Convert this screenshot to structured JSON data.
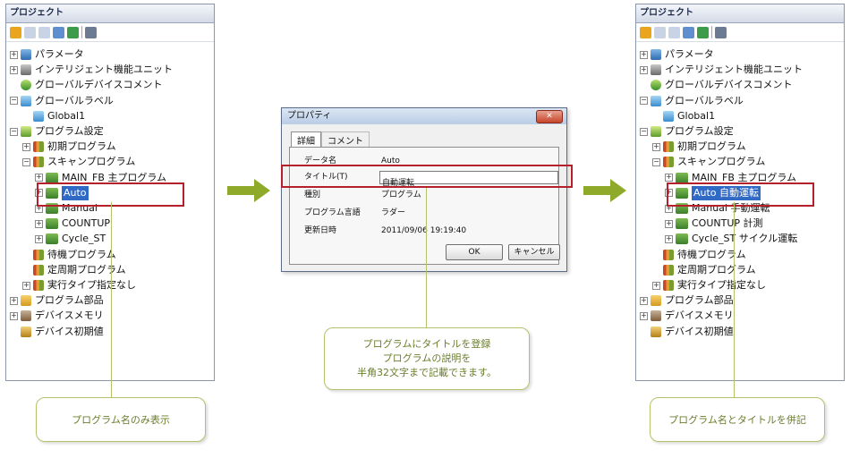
{
  "left_panel": {
    "title": "プロジェクト",
    "tree": [
      {
        "label": "パラメータ"
      },
      {
        "label": "インテリジェント機能ユニット"
      },
      {
        "label": "グローバルデバイスコメント"
      },
      {
        "label": "グローバルラベル"
      },
      {
        "label": "Global1"
      },
      {
        "label": "プログラム設定"
      },
      {
        "label": "初期プログラム"
      },
      {
        "label": "スキャンプログラム"
      },
      {
        "label": "MAIN_FB 主プログラム"
      },
      {
        "label": "Auto"
      },
      {
        "label": "Manual"
      },
      {
        "label": "COUNTUP"
      },
      {
        "label": "Cycle_ST"
      },
      {
        "label": "待機プログラム"
      },
      {
        "label": "定周期プログラム"
      },
      {
        "label": "実行タイプ指定なし"
      },
      {
        "label": "プログラム部品"
      },
      {
        "label": "デバイスメモリ"
      },
      {
        "label": "デバイス初期値"
      }
    ],
    "callout": "プログラム名のみ表示"
  },
  "dialog": {
    "title": "プロパティ",
    "tabs": [
      "詳細",
      "コメント"
    ],
    "rows": [
      {
        "label": "データ名",
        "value": "Auto"
      },
      {
        "label": "タイトル(T)",
        "value": "自動運転"
      },
      {
        "label": "種別",
        "value": "プログラム"
      },
      {
        "label": "プログラム言語",
        "value": "ラダー"
      },
      {
        "label": "更新日時",
        "value": "2011/09/06 19:19:40"
      }
    ],
    "ok_label": "OK",
    "cancel_label": "キャンセル",
    "callout_lines": [
      "プログラムにタイトルを登録",
      "プログラムの説明を",
      "半角32文字まで記載できます。"
    ]
  },
  "right_panel": {
    "title": "プロジェクト",
    "tree": [
      {
        "label": "パラメータ"
      },
      {
        "label": "インテリジェント機能ユニット"
      },
      {
        "label": "グローバルデバイスコメント"
      },
      {
        "label": "グローバルラベル"
      },
      {
        "label": "Global1"
      },
      {
        "label": "プログラム設定"
      },
      {
        "label": "初期プログラム"
      },
      {
        "label": "スキャンプログラム"
      },
      {
        "label": "MAIN_FB 主プログラム"
      },
      {
        "label": "Auto 自動運転"
      },
      {
        "label": "Manual 手動運転"
      },
      {
        "label": "COUNTUP 計測"
      },
      {
        "label": "Cycle_ST サイクル運転"
      },
      {
        "label": "待機プログラム"
      },
      {
        "label": "定周期プログラム"
      },
      {
        "label": "実行タイプ指定なし"
      },
      {
        "label": "プログラム部品"
      },
      {
        "label": "デバイスメモリ"
      },
      {
        "label": "デバイス初期値"
      }
    ],
    "callout": "プログラム名とタイトルを併記"
  },
  "colors": {
    "highlight_box": "#b5202a",
    "arrow": "#8faa2a",
    "callout_text": "#6a7d2b",
    "selection": "#316ac5"
  }
}
